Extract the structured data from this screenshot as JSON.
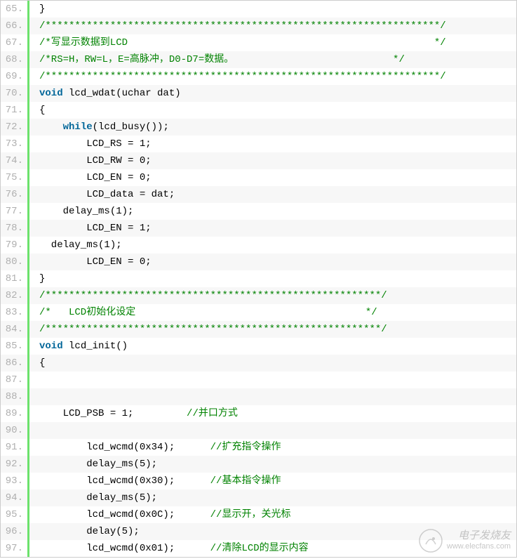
{
  "lines": [
    {
      "n": "65.",
      "indent": 0,
      "tokens": [
        {
          "t": "}",
          "c": "p"
        }
      ]
    },
    {
      "n": "66.",
      "indent": 0,
      "tokens": [
        {
          "t": "/*******************************************************************/",
          "c": "cmt"
        }
      ]
    },
    {
      "n": "67.",
      "indent": 0,
      "tokens": [
        {
          "t": "/*写显示数据到LCD                                                    */",
          "c": "cmt"
        }
      ]
    },
    {
      "n": "68.",
      "indent": 0,
      "tokens": [
        {
          "t": "/*RS=H，RW=L，E=高脉冲，D0-D7=数据。                           */",
          "c": "cmt"
        }
      ]
    },
    {
      "n": "69.",
      "indent": 0,
      "tokens": [
        {
          "t": "/*******************************************************************/",
          "c": "cmt"
        }
      ]
    },
    {
      "n": "70.",
      "indent": 0,
      "tokens": [
        {
          "t": "void",
          "c": "kw"
        },
        {
          "t": " lcd_wdat(uchar dat)",
          "c": "p"
        }
      ]
    },
    {
      "n": "71.",
      "indent": 0,
      "tokens": [
        {
          "t": "{",
          "c": "p"
        }
      ]
    },
    {
      "n": "72.",
      "indent": 1,
      "tokens": [
        {
          "t": "while",
          "c": "kw"
        },
        {
          "t": "(lcd_busy());",
          "c": "p"
        }
      ]
    },
    {
      "n": "73.",
      "indent": 2,
      "tokens": [
        {
          "t": "LCD_RS = 1;",
          "c": "p"
        }
      ]
    },
    {
      "n": "74.",
      "indent": 2,
      "tokens": [
        {
          "t": "LCD_RW = 0;",
          "c": "p"
        }
      ]
    },
    {
      "n": "75.",
      "indent": 2,
      "tokens": [
        {
          "t": "LCD_EN = 0;",
          "c": "p"
        }
      ]
    },
    {
      "n": "76.",
      "indent": 2,
      "tokens": [
        {
          "t": "LCD_data = dat;",
          "c": "p"
        }
      ]
    },
    {
      "n": "77.",
      "indent": 1,
      "tokens": [
        {
          "t": "delay_ms(1);",
          "c": "p"
        }
      ]
    },
    {
      "n": "78.",
      "indent": 2,
      "tokens": [
        {
          "t": "LCD_EN = 1;",
          "c": "p"
        }
      ]
    },
    {
      "n": "79.",
      "indent": 0,
      "tokens": [
        {
          "t": "  delay_ms(1);",
          "c": "p"
        }
      ]
    },
    {
      "n": "80.",
      "indent": 2,
      "tokens": [
        {
          "t": "LCD_EN = 0;",
          "c": "p"
        }
      ]
    },
    {
      "n": "81.",
      "indent": 0,
      "tokens": [
        {
          "t": "}",
          "c": "p"
        }
      ]
    },
    {
      "n": "82.",
      "indent": 0,
      "tokens": [
        {
          "t": "/*********************************************************/",
          "c": "cmt"
        }
      ]
    },
    {
      "n": "83.",
      "indent": 0,
      "tokens": [
        {
          "t": "/*   LCD初始化设定                                       */",
          "c": "cmt"
        }
      ]
    },
    {
      "n": "84.",
      "indent": 0,
      "tokens": [
        {
          "t": "/*********************************************************/",
          "c": "cmt"
        }
      ]
    },
    {
      "n": "85.",
      "indent": 0,
      "tokens": [
        {
          "t": "void",
          "c": "kw"
        },
        {
          "t": " lcd_init()",
          "c": "p"
        }
      ]
    },
    {
      "n": "86.",
      "indent": 0,
      "tokens": [
        {
          "t": "{",
          "c": "p"
        }
      ]
    },
    {
      "n": "87.",
      "indent": 0,
      "tokens": []
    },
    {
      "n": "88.",
      "indent": 0,
      "tokens": []
    },
    {
      "n": "89.",
      "indent": 1,
      "tokens": [
        {
          "t": "LCD_PSB = 1;         ",
          "c": "p"
        },
        {
          "t": "//并口方式",
          "c": "cmt"
        }
      ]
    },
    {
      "n": "90.",
      "indent": 0,
      "tokens": []
    },
    {
      "n": "91.",
      "indent": 2,
      "tokens": [
        {
          "t": "lcd_wcmd(0x34);      ",
          "c": "p"
        },
        {
          "t": "//扩充指令操作",
          "c": "cmt"
        }
      ]
    },
    {
      "n": "92.",
      "indent": 2,
      "tokens": [
        {
          "t": "delay_ms(5);",
          "c": "p"
        }
      ]
    },
    {
      "n": "93.",
      "indent": 2,
      "tokens": [
        {
          "t": "lcd_wcmd(0x30);      ",
          "c": "p"
        },
        {
          "t": "//基本指令操作",
          "c": "cmt"
        }
      ]
    },
    {
      "n": "94.",
      "indent": 2,
      "tokens": [
        {
          "t": "delay_ms(5);",
          "c": "p"
        }
      ]
    },
    {
      "n": "95.",
      "indent": 2,
      "tokens": [
        {
          "t": "lcd_wcmd(0x0C);      ",
          "c": "p"
        },
        {
          "t": "//显示开，关光标",
          "c": "cmt"
        }
      ]
    },
    {
      "n": "96.",
      "indent": 2,
      "tokens": [
        {
          "t": "delay(5);",
          "c": "p"
        }
      ]
    },
    {
      "n": "97.",
      "indent": 2,
      "tokens": [
        {
          "t": "lcd_wcmd(0x01);      ",
          "c": "p"
        },
        {
          "t": "//清除LCD的显示内容",
          "c": "cmt"
        }
      ]
    }
  ],
  "watermark": {
    "zh": "电子发烧友",
    "en": "www.elecfans.com"
  }
}
